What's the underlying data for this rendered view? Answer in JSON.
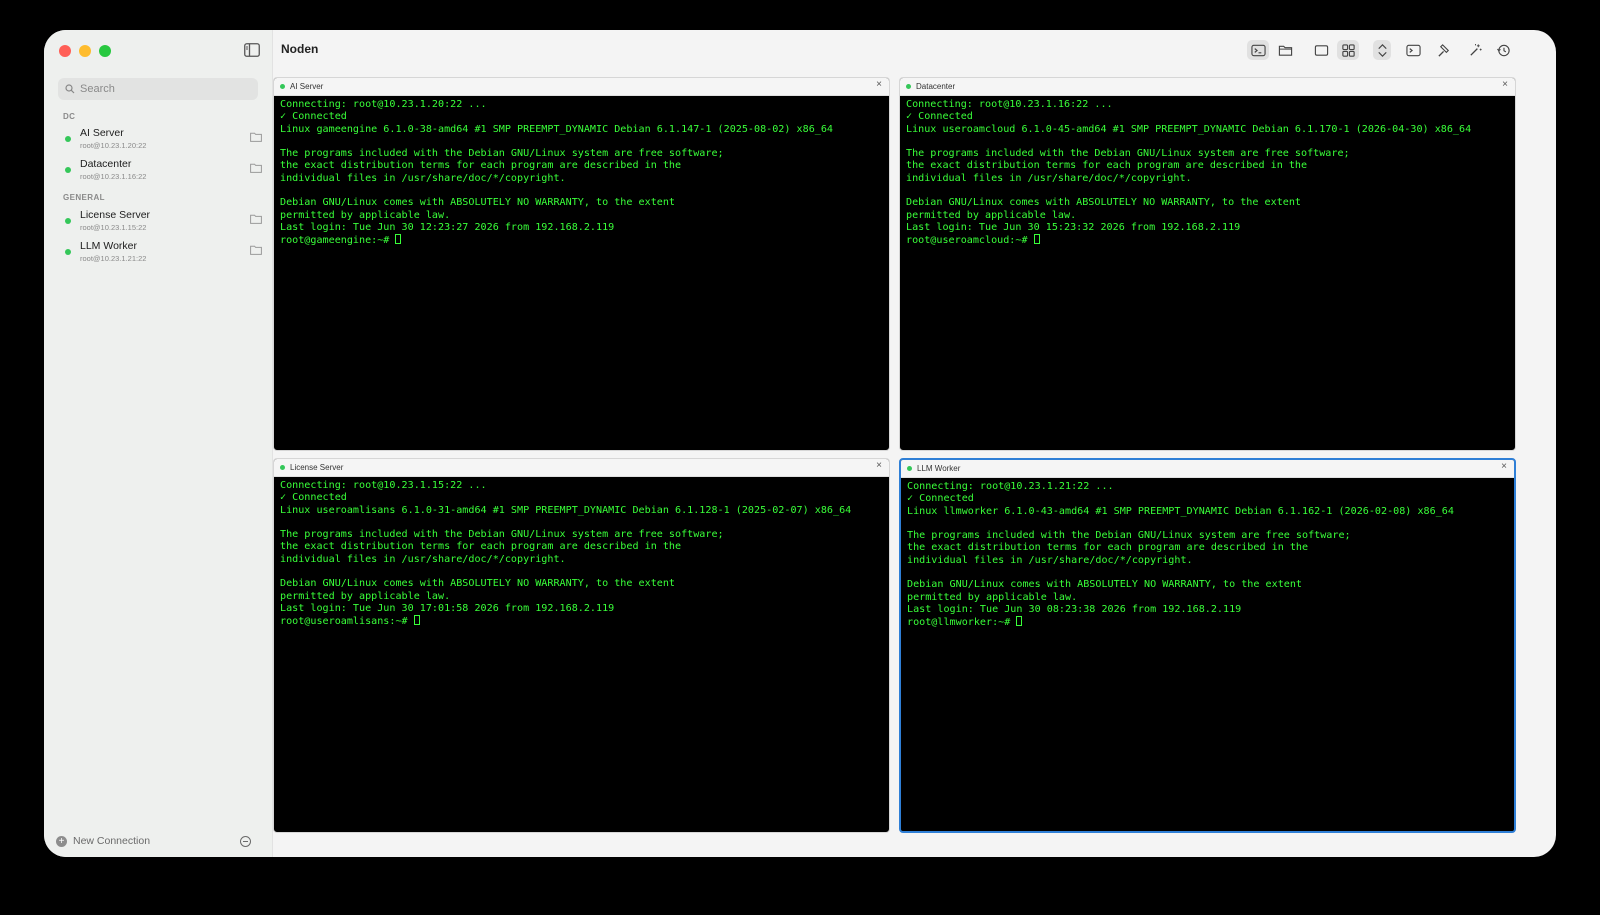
{
  "app": {
    "title": "Noden"
  },
  "sidebar": {
    "search_placeholder": "Search",
    "groups": [
      {
        "label": "DC",
        "hosts": [
          {
            "name": "AI Server",
            "address": "root@10.23.1.20:22"
          },
          {
            "name": "Datacenter",
            "address": "root@10.23.1.16:22"
          }
        ]
      },
      {
        "label": "GENERAL",
        "hosts": [
          {
            "name": "License Server",
            "address": "root@10.23.1.15:22"
          },
          {
            "name": "LLM Worker",
            "address": "root@10.23.1.21:22"
          }
        ]
      }
    ],
    "new_connection": "New Connection"
  },
  "toolbar": {
    "icons": [
      "terminal-icon",
      "folder-icon",
      "single-pane-icon",
      "grid-layout-icon",
      "expand-collapse-icon",
      "console-icon",
      "hammer-icon",
      "wand-icon",
      "history-icon"
    ]
  },
  "colors": {
    "accent": "#2f7fd6",
    "status_online": "#34c759",
    "terminal_text": "#39ff39",
    "terminal_bg": "#000000"
  },
  "panes": [
    {
      "title": "AI Server",
      "lines": [
        "Connecting: root@10.23.1.20:22 ...",
        "✓ Connected",
        "Linux gameengine 6.1.0-38-amd64 #1 SMP PREEMPT_DYNAMIC Debian 6.1.147-1 (2025-08-02) x86_64",
        "",
        "The programs included with the Debian GNU/Linux system are free software;",
        "the exact distribution terms for each program are described in the",
        "individual files in /usr/share/doc/*/copyright.",
        "",
        "Debian GNU/Linux comes with ABSOLUTELY NO WARRANTY, to the extent",
        "permitted by applicable law.",
        "Last login: Tue Jun 30 12:23:27 2026 from 192.168.2.119"
      ],
      "prompt": "root@gameengine:~# "
    },
    {
      "title": "Datacenter",
      "lines": [
        "Connecting: root@10.23.1.16:22 ...",
        "✓ Connected",
        "Linux useroamcloud 6.1.0-45-amd64 #1 SMP PREEMPT_DYNAMIC Debian 6.1.170-1 (2026-04-30) x86_64",
        "",
        "The programs included with the Debian GNU/Linux system are free software;",
        "the exact distribution terms for each program are described in the",
        "individual files in /usr/share/doc/*/copyright.",
        "",
        "Debian GNU/Linux comes with ABSOLUTELY NO WARRANTY, to the extent",
        "permitted by applicable law.",
        "Last login: Tue Jun 30 15:23:32 2026 from 192.168.2.119"
      ],
      "prompt": "root@useroamcloud:~# "
    },
    {
      "title": "License Server",
      "lines": [
        "Connecting: root@10.23.1.15:22 ...",
        "✓ Connected",
        "Linux useroamlisans 6.1.0-31-amd64 #1 SMP PREEMPT_DYNAMIC Debian 6.1.128-1 (2025-02-07) x86_64",
        "",
        "The programs included with the Debian GNU/Linux system are free software;",
        "the exact distribution terms for each program are described in the",
        "individual files in /usr/share/doc/*/copyright.",
        "",
        "Debian GNU/Linux comes with ABSOLUTELY NO WARRANTY, to the extent",
        "permitted by applicable law.",
        "Last login: Tue Jun 30 17:01:58 2026 from 192.168.2.119"
      ],
      "prompt": "root@useroamlisans:~# "
    },
    {
      "title": "LLM Worker",
      "lines": [
        "Connecting: root@10.23.1.21:22 ...",
        "✓ Connected",
        "Linux llmworker 6.1.0-43-amd64 #1 SMP PREEMPT_DYNAMIC Debian 6.1.162-1 (2026-02-08) x86_64",
        "",
        "The programs included with the Debian GNU/Linux system are free software;",
        "the exact distribution terms for each program are described in the",
        "individual files in /usr/share/doc/*/copyright.",
        "",
        "Debian GNU/Linux comes with ABSOLUTELY NO WARRANTY, to the extent",
        "permitted by applicable law.",
        "Last login: Tue Jun 30 08:23:38 2026 from 192.168.2.119"
      ],
      "prompt": "root@llmworker:~# "
    }
  ]
}
